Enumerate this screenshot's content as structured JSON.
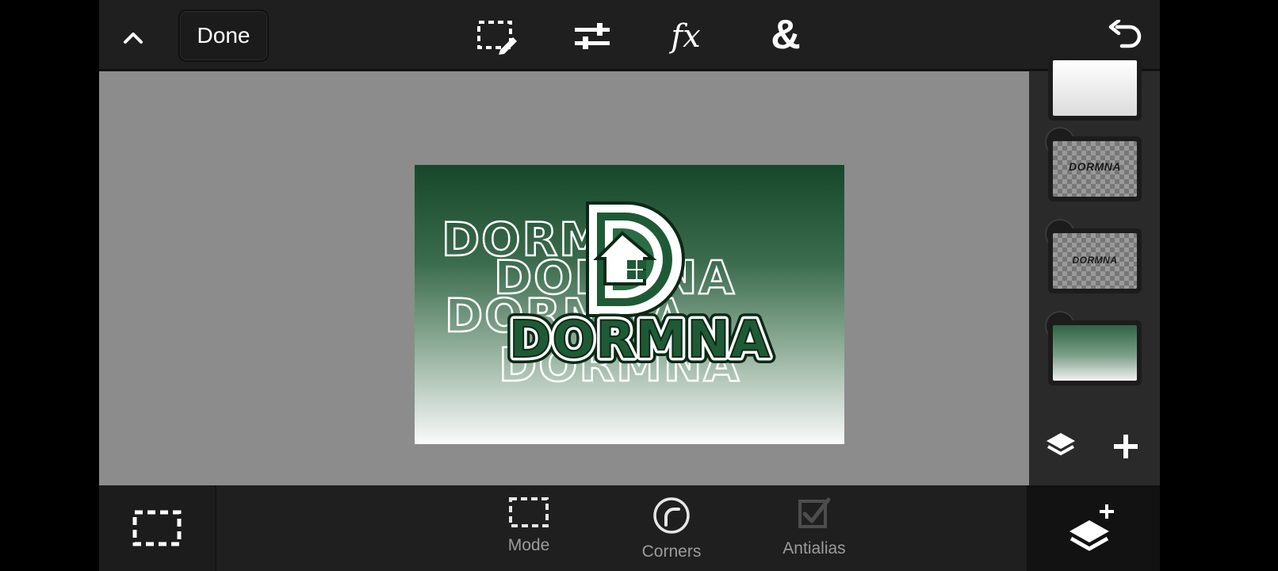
{
  "topbar": {
    "done_label": "Done",
    "fx_label": "fx",
    "blend_label": "&",
    "icons": [
      "chevron-up-icon",
      "selection-edit-icon",
      "adjustments-icon",
      "fx-icon",
      "blend-icon",
      "undo-icon"
    ]
  },
  "artwork": {
    "logo_text": "DORMNA",
    "outline_text": "DORMNA",
    "colors": {
      "dark_green": "#17472a",
      "mid_green": "#3b6c4d",
      "white": "#fafafa"
    }
  },
  "layers": {
    "items": [
      {
        "name": "white-layer",
        "thumb": "white",
        "selected": false
      },
      {
        "name": "dormna-text-layer",
        "thumb": "checker",
        "thumb_text": "DORMNA",
        "selected": false
      },
      {
        "name": "dormna-small-layer",
        "thumb": "checker",
        "thumb_text": "DORMNA",
        "selected": false
      },
      {
        "name": "gradient-layer",
        "thumb": "gradient",
        "selected": true
      }
    ]
  },
  "bottombar": {
    "tools": [
      {
        "label": "Mode",
        "icon": "dashed-rect-icon"
      },
      {
        "label": "Corners",
        "icon": "corners-icon"
      },
      {
        "label": "Antialias",
        "icon": "antialias-checkbox-icon"
      }
    ]
  },
  "colors": {
    "bg": "#1f1f1f",
    "canvas_bg": "#8c8c8c",
    "panel": "#2a2a2a",
    "label_gray": "#9c9c9c"
  }
}
